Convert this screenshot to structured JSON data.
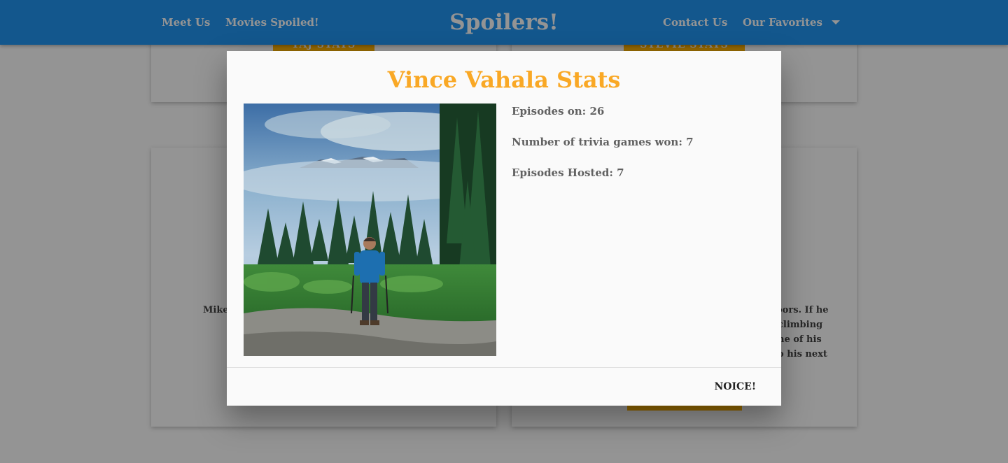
{
  "nav": {
    "meet_us": "Meet Us",
    "movies_spoiled": "Movies Spoiled!",
    "brand": "Spoilers!",
    "contact_us": "Contact Us",
    "our_favorites": "Our Favorites",
    "dropdown_icon": "caret-down-icon"
  },
  "cards": {
    "top_left_button": "TAJ STATS",
    "top_right_button": "STEVIE STATS",
    "bottom_left_text": "Mike",
    "bottom_right_lines": [
      "oors. If he",
      "climbing",
      "ne of his",
      "o his next"
    ]
  },
  "modal": {
    "title": "Vince Vahala Stats",
    "photo_alt": "Vince Vahala hiking in a mountain forest",
    "stats": [
      "Episodes on: 26",
      "Number of trivia games won: 7",
      "Episodes Hosted: 7"
    ],
    "close_label": "NOICE!"
  },
  "colors": {
    "navbar": "#2196f3",
    "title_accent": "#f9a825",
    "card_button": "#ffb300"
  }
}
